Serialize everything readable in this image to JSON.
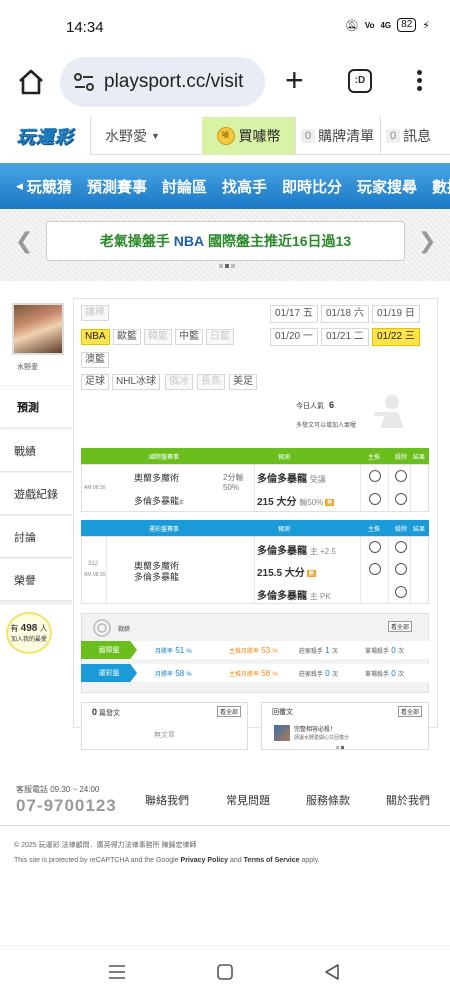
{
  "status_bar": {
    "time": "14:34",
    "battery": "82",
    "signal_text": "4G"
  },
  "browser": {
    "url": "playsport.cc/visit",
    "tabs_label": ":D"
  },
  "site_header": {
    "logo": "玩運彩",
    "user_menu": "水野愛",
    "buy_coin": "買噱幣",
    "cart_count": "0",
    "cart_label": "購牌清單",
    "msg_count": "0",
    "msg_label": "訊息"
  },
  "nav": [
    "玩競猜",
    "預測賽事",
    "討論區",
    "找高手",
    "即時比分",
    "玩家搜尋",
    "數據"
  ],
  "banner": {
    "prefix": "老氣操盤手",
    "highlight": "NBA",
    "rest": "國際盤主推近16日過13"
  },
  "profile": {
    "name": "水野愛"
  },
  "side_tabs": [
    "預測",
    "戰績",
    "遊戲紀錄",
    "討論",
    "榮譽"
  ],
  "helped": {
    "prefix": "有",
    "count": "498",
    "unit": "人",
    "suffix": "加入我的最愛"
  },
  "leagues": [
    {
      "label": "讓棒",
      "state": "dim"
    },
    {
      "label": "NBA",
      "state": "selected"
    },
    {
      "label": "歐籃",
      "state": "normal"
    },
    {
      "label": "韓籃",
      "state": "dim"
    },
    {
      "label": "中籃",
      "state": "normal"
    },
    {
      "label": "日籃",
      "state": "dim"
    },
    {
      "label": "澳籃",
      "state": "normal"
    },
    {
      "label": "足球",
      "state": "normal"
    },
    {
      "label": "NHL冰球",
      "state": "normal"
    },
    {
      "label": "俄冰",
      "state": "dim"
    },
    {
      "label": "長馬",
      "state": "dim"
    },
    {
      "label": "美足",
      "state": "normal"
    }
  ],
  "dates": [
    {
      "date": "01/17",
      "day": "五",
      "selected": false
    },
    {
      "date": "01/18",
      "day": "六",
      "selected": false
    },
    {
      "date": "01/19",
      "day": "日",
      "selected": false
    },
    {
      "date": "01/20",
      "day": "一",
      "selected": false
    },
    {
      "date": "01/21",
      "day": "二",
      "selected": false
    },
    {
      "date": "01/22",
      "day": "三",
      "selected": true
    }
  ],
  "visitors": {
    "label": "今日人氣",
    "count": "6",
    "note": "多發文可以增加人氣喔"
  },
  "table_intl": {
    "header": {
      "game": "國際盤賽事",
      "pick": "預測",
      "main": "主推",
      "kill": "殺除",
      "result": "結果"
    },
    "time": "AM 08:30",
    "home": "奧蘭多魔術",
    "away": "多倫多暴龍",
    "away_sup": "㊣",
    "spread": "2分輸",
    "spread_pct": "50%",
    "picks": [
      {
        "team": "多倫多暴龍",
        "note": "受讓"
      },
      {
        "team": "215 大分",
        "note": "輸50%",
        "tag": "熱"
      }
    ]
  },
  "table_tw": {
    "header": {
      "game": "運彩盤賽事",
      "pick": "預測",
      "main": "主推",
      "kill": "殺除",
      "result": "結果"
    },
    "game_no": "312",
    "time": "AM 08:30",
    "home": "奧蘭多魔術",
    "away": "多倫多暴龍",
    "picks": [
      {
        "team": "多倫多暴龍",
        "note": "主 +2.5"
      },
      {
        "team": "215.5 大分",
        "note": "",
        "tag": "熱"
      },
      {
        "team": "多倫多暴龍",
        "note": "主 PK"
      }
    ]
  },
  "record": {
    "title": "戰績",
    "see_all": "看全部",
    "rows": [
      {
        "label": "國際盤",
        "win_rate_label": "月勝率",
        "win_rate": "51",
        "main_rate_label": "主推月勝率",
        "main_rate": "53",
        "streak_label": "莊家殺手",
        "streak": "1",
        "streak2_label": "單場殺手",
        "streak2": "0",
        "unit": "次",
        "pct": "%"
      },
      {
        "label": "運彩盤",
        "win_rate_label": "月勝率",
        "win_rate": "58",
        "main_rate_label": "主推月勝率",
        "main_rate": "58",
        "streak_label": "莊家殺手",
        "streak": "0",
        "streak2_label": "單場殺手",
        "streak2": "0",
        "unit": "次",
        "pct": "%"
      }
    ]
  },
  "posts_box": {
    "count": "0",
    "label": "篇發文",
    "see_all": "看全部",
    "empty": "無文章"
  },
  "replies_box": {
    "label": "回覆文",
    "see_all": "看全部",
    "item_title": "完整相容必殺！",
    "item_sub": "請讓水野愛開心又回復分"
  },
  "footer": {
    "hotline": "客服電話 09:30 ~ 24:00",
    "phone": "07-9700123",
    "links": [
      "聯絡我們",
      "常見問題",
      "服務條款",
      "關於我們"
    ],
    "copyright": "© 2025 玩運彩 法律顧問．廣英得力法律事務所 陳錦宏律師",
    "recaptcha_pre": "This site is protected by reCAPTCHA and the Google ",
    "privacy": "Privacy Policy",
    "and": " and ",
    "terms": "Terms of Service",
    "recaptcha_post": " apply."
  },
  "colors": {
    "nav_blue": "#1b78c6",
    "intl_green": "#6abf1e",
    "tw_blue": "#1a9ad6",
    "selected_yellow": "#ffe44d"
  }
}
